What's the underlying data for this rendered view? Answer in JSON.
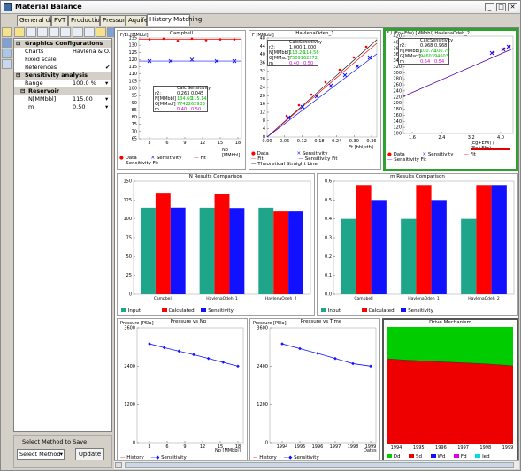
{
  "window": {
    "title": "Material Balance"
  },
  "tabs": [
    "General data",
    "PVT",
    "Production",
    "Pressure",
    "Aquifer",
    "History Matching"
  ],
  "panel": {
    "graphics_section": "Graphics Configurations",
    "charts_label": "Charts",
    "charts_value": "Havlena & O...",
    "fixed_scale_label": "Fixed scale",
    "references_label": "References",
    "references_value": "✔",
    "sensitivity_section": "Sensitivity analysis",
    "range_label": "Range",
    "range_value": "100.0 %",
    "reservoir_section": "Reservoir",
    "n_label": "N[MMbbl]",
    "n_value": "115.00",
    "m_label": "m",
    "m_value": "0.50"
  },
  "method": {
    "label": "Select Method to Save",
    "select_value": "Select Method",
    "update_label": "Update"
  },
  "charts": {
    "campbell": {
      "title": "Campbell",
      "ylabel": "F/Et [MMbbl]",
      "xlabel": "Np [MMbbl]",
      "yticks": [
        "135",
        "130",
        "125",
        "120",
        "115",
        "110",
        "105",
        "100",
        "95",
        "90",
        "85",
        "80",
        "75",
        "70",
        "65"
      ],
      "xticks": [
        "3",
        "6",
        "9",
        "12",
        "15",
        "18"
      ],
      "stats_header_calc": "Calc",
      "stats_header_sens": "Sensitivity",
      "stats": [
        [
          "r2:",
          "0.263",
          "0.045"
        ],
        [
          "N[MMbbl]",
          "134.60",
          "115.14"
        ],
        [
          "G[MMscf]",
          "77422",
          "62933"
        ],
        [
          "m",
          "0.40",
          "0.50"
        ]
      ],
      "legend": [
        "Data",
        "Sensitivity",
        "Fit",
        "Sensitivity Fit"
      ]
    },
    "havlena1": {
      "title": "HavlenaOdeh_1",
      "ylabel": "F [MMbbl]",
      "xlabel": "Et [bbl/stb]",
      "yticks": [
        "48",
        "44",
        "40",
        "36",
        "32",
        "28",
        "24",
        "20",
        "16",
        "12",
        "8",
        "4",
        "0"
      ],
      "xticks": [
        "0.00",
        "0.06",
        "0.12",
        "0.18",
        "0.24",
        "0.30",
        "0.36"
      ],
      "stats_header_calc": "Calc",
      "stats_header_sens": "Sensitivity",
      "stats": [
        [
          "r2:",
          "1.000",
          "1.000"
        ],
        [
          "N[MMbbl]",
          "113.26",
          "114.56"
        ],
        [
          "G[MMscf]",
          "75091",
          "62272"
        ],
        [
          "m",
          "0.40",
          "0.50"
        ]
      ],
      "legend": [
        "Data",
        "Sensitivity",
        "Fit",
        "Sensitivity Fit",
        "Theoretical Straight Line"
      ]
    },
    "havlena2": {
      "title": "F / (Eo+Efw) [MMbbl] HavlenaOdeh_2",
      "xlabel": "(Eg+Efw) / (Eo+Efw)",
      "yticks": [
        "420",
        "400",
        "380",
        "360",
        "340",
        "320",
        "300",
        "280",
        "260",
        "240",
        "220",
        "200",
        "180",
        "160",
        "140",
        "120",
        "100"
      ],
      "xticks": [
        "1.6",
        "2.4",
        "3.2",
        "4.0"
      ],
      "stats_header_calc": "Calc",
      "stats_header_sens": "Sensitivity",
      "stats": [
        [
          "r2:",
          "0.968",
          "0.968"
        ],
        [
          "N[MMbbl]",
          "100.70",
          "100.70"
        ],
        [
          "G[MMscf]",
          "94603",
          "94603"
        ],
        [
          "m",
          "0.54",
          "0.54"
        ]
      ],
      "legend": [
        "Data",
        "Sensitivity",
        "Fit",
        "Sensitivity Fit"
      ]
    },
    "n_results": {
      "title": "N Results Comparison",
      "categories": [
        "Campbell",
        "HavlenaOdeh_1",
        "HavlenaOdeh_2"
      ],
      "yticks": [
        "150",
        "125",
        "100",
        "75",
        "50",
        "25",
        "0"
      ],
      "legend": [
        "Input",
        "Calculated",
        "Sensitivity"
      ]
    },
    "m_results": {
      "title": "m Results Comparison",
      "categories": [
        "Campbell",
        "HavlenaOdeh_1",
        "HavlenaOdeh_2"
      ],
      "yticks": [
        "0.6",
        "0.5",
        "0.4",
        "0.3",
        "0.2",
        "0.1",
        "0.0"
      ],
      "legend": [
        "Input",
        "Calculated",
        "Sensitivity"
      ]
    },
    "pressure_np": {
      "title": "Pressure vs Np",
      "ylabel": "Pressure [PSIa]",
      "xlabel": "Np [MMbbl]",
      "yticks": [
        "3600",
        "2400",
        "1200",
        "0"
      ],
      "xticks": [
        "3",
        "6",
        "9",
        "12",
        "15",
        "18"
      ],
      "legend": [
        "History",
        "Sensitivity"
      ]
    },
    "pressure_time": {
      "title": "Pressure vs Time",
      "ylabel": "Pressure [PSIa]",
      "xlabel": "Dates",
      "yticks": [
        "3600",
        "2400",
        "1200",
        "0"
      ],
      "xticks": [
        "1994",
        "1995",
        "1996",
        "1997",
        "1998",
        "1999"
      ],
      "legend": [
        "History",
        "Sensitivity"
      ]
    },
    "drive": {
      "title": "Drive Mechanism",
      "xticks": [
        "1994",
        "1995",
        "1996",
        "1997",
        "1998",
        "1999"
      ],
      "legend": [
        "Dd",
        "Sd",
        "Wd",
        "Fd",
        "Ied"
      ]
    }
  },
  "chart_data": [
    {
      "type": "bar",
      "title": "N Results Comparison",
      "categories": [
        "Campbell",
        "HavlenaOdeh_1",
        "HavlenaOdeh_2"
      ],
      "ylim": [
        0,
        150
      ],
      "series": [
        {
          "name": "Input",
          "values": [
            115,
            115,
            115
          ]
        },
        {
          "name": "Calculated",
          "values": [
            134.6,
            132.5,
            110
          ]
        },
        {
          "name": "Sensitivity",
          "values": [
            115.1,
            114.6,
            110
          ]
        }
      ]
    },
    {
      "type": "bar",
      "title": "m Results Comparison",
      "categories": [
        "Campbell",
        "HavlenaOdeh_1",
        "HavlenaOdeh_2"
      ],
      "ylim": [
        0,
        0.6
      ],
      "series": [
        {
          "name": "Input",
          "values": [
            0.4,
            0.4,
            0.4
          ]
        },
        {
          "name": "Calculated",
          "values": [
            0.58,
            0.58,
            0.58
          ]
        },
        {
          "name": "Sensitivity",
          "values": [
            0.5,
            0.5,
            0.58
          ]
        }
      ]
    },
    {
      "type": "line",
      "title": "Pressure vs Np",
      "xlabel": "Np [MMbbl]",
      "ylabel": "Pressure [PSIa]",
      "ylim": [
        0,
        3600
      ],
      "x": [
        3,
        5.5,
        8,
        10.5,
        13,
        15.5,
        18
      ],
      "series": [
        {
          "name": "History",
          "values": [
            3100,
            2980,
            2870,
            2760,
            2640,
            2520,
            2400
          ]
        }
      ]
    },
    {
      "type": "line",
      "title": "Pressure vs Time",
      "xlabel": "Dates",
      "ylabel": "Pressure [PSIa]",
      "ylim": [
        0,
        3600
      ],
      "x": [
        "1994",
        "1995",
        "1996",
        "1997",
        "1998",
        "1999"
      ],
      "series": [
        {
          "name": "History",
          "values": [
            3100,
            2950,
            2800,
            2640,
            2480,
            2400
          ]
        }
      ]
    }
  ],
  "colors": {
    "red": "#ff0000",
    "blue": "#1a1aff",
    "teal": "#1ea58a",
    "green": "#00cc00",
    "selection": "#2fa12f"
  }
}
